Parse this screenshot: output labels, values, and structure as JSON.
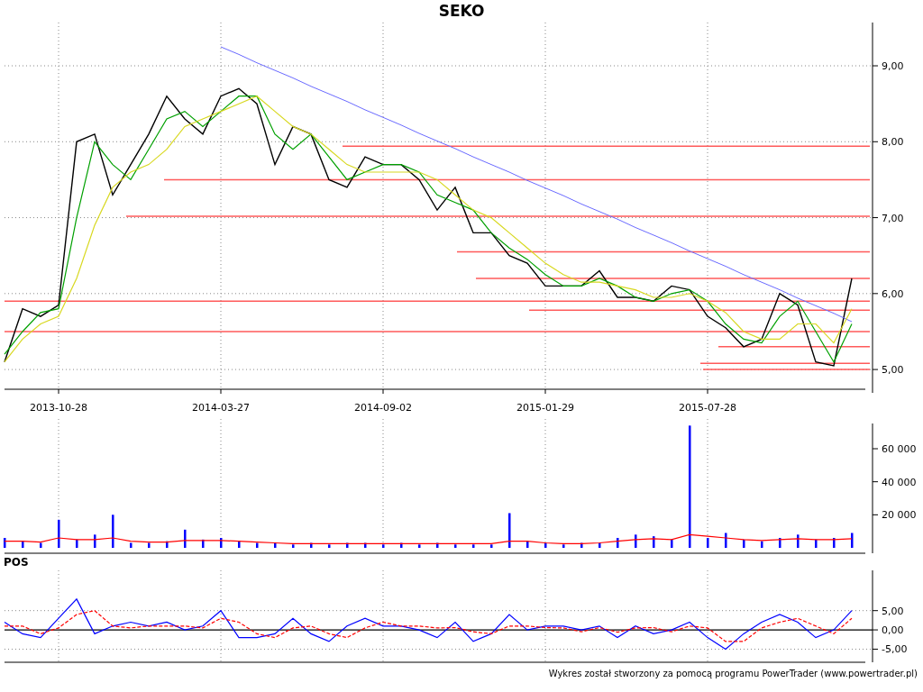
{
  "title": "SEKO",
  "price_panel": {
    "chart_data": {
      "type": "line",
      "grid": true,
      "categories": [
        null,
        null,
        null,
        "2013-10-28",
        null,
        null,
        null,
        null,
        null,
        null,
        null,
        null,
        "2014-03-27",
        null,
        null,
        null,
        null,
        null,
        null,
        null,
        null,
        "2014-09-02",
        null,
        null,
        null,
        null,
        null,
        null,
        null,
        null,
        "2015-01-29",
        null,
        null,
        null,
        null,
        null,
        null,
        null,
        null,
        "2015-07-28",
        null,
        null,
        null,
        null,
        null,
        null,
        null,
        null
      ],
      "ylim": [
        4.74,
        9.57
      ],
      "yticks": [
        {
          "value": 5,
          "label": "5,00"
        },
        {
          "value": 6,
          "label": "6,00"
        },
        {
          "value": 7,
          "label": "7,00"
        },
        {
          "value": 8,
          "label": "8,00"
        },
        {
          "value": 9,
          "label": "9,00"
        }
      ],
      "series": [
        {
          "color": "#000000",
          "values": [
            5.1,
            5.8,
            5.7,
            5.85,
            8.0,
            8.1,
            7.3,
            7.7,
            8.1,
            8.6,
            8.3,
            8.1,
            8.6,
            8.7,
            8.5,
            7.7,
            8.2,
            8.1,
            7.5,
            7.4,
            7.8,
            7.7,
            7.7,
            7.5,
            7.1,
            7.4,
            6.8,
            6.8,
            6.5,
            6.4,
            6.1,
            6.1,
            6.1,
            6.3,
            5.95,
            5.95,
            5.9,
            6.1,
            6.05,
            5.7,
            5.55,
            5.3,
            5.4,
            6.0,
            5.85,
            5.1,
            5.05,
            6.2
          ]
        },
        {
          "color": "#00a000",
          "values": [
            5.2,
            5.5,
            5.75,
            5.8,
            7.0,
            8.0,
            7.7,
            7.5,
            7.9,
            8.3,
            8.4,
            8.2,
            8.4,
            8.6,
            8.6,
            8.1,
            7.9,
            8.1,
            7.8,
            7.5,
            7.6,
            7.7,
            7.7,
            7.6,
            7.3,
            7.2,
            7.1,
            6.8,
            6.6,
            6.45,
            6.25,
            6.1,
            6.1,
            6.2,
            6.1,
            5.95,
            5.9,
            6.0,
            6.05,
            5.9,
            5.6,
            5.4,
            5.35,
            5.7,
            5.9,
            5.5,
            5.1,
            5.6
          ]
        },
        {
          "color": "#d8d820",
          "values": [
            5.1,
            5.4,
            5.6,
            5.7,
            6.2,
            6.9,
            7.4,
            7.6,
            7.7,
            7.9,
            8.2,
            8.3,
            8.4,
            8.5,
            8.6,
            8.4,
            8.2,
            8.1,
            7.9,
            7.7,
            7.6,
            7.6,
            7.6,
            7.6,
            7.5,
            7.3,
            7.1,
            7.0,
            6.8,
            6.6,
            6.4,
            6.25,
            6.15,
            6.15,
            6.1,
            6.05,
            5.95,
            5.95,
            6.0,
            5.9,
            5.75,
            5.5,
            5.4,
            5.4,
            5.6,
            5.6,
            5.35,
            5.8
          ]
        },
        {
          "color": "#6a6aff",
          "values": [
            null,
            null,
            null,
            null,
            null,
            null,
            null,
            null,
            null,
            null,
            null,
            null,
            9.25,
            9.15,
            9.04,
            8.94,
            8.84,
            8.73,
            8.63,
            8.53,
            8.42,
            8.32,
            8.22,
            8.11,
            8.01,
            7.91,
            7.8,
            7.7,
            7.6,
            7.49,
            7.39,
            7.29,
            7.18,
            7.08,
            6.98,
            6.87,
            6.77,
            6.67,
            6.56,
            6.46,
            6.36,
            6.25,
            6.15,
            6.05,
            5.94,
            5.84,
            5.74,
            5.63
          ]
        }
      ],
      "ref_lines": [
        {
          "axis": "y",
          "value": 7.94,
          "color": "#ff5a5a"
        },
        {
          "axis": "y",
          "value": 7.5,
          "color": "#ff5a5a"
        },
        {
          "axis": "y",
          "value": 7.02,
          "color": "#ff5a5a"
        },
        {
          "axis": "y",
          "value": 6.55,
          "color": "#ff5a5a"
        },
        {
          "axis": "y",
          "value": 6.2,
          "color": "#ff5a5a"
        },
        {
          "axis": "y",
          "value": 5.9,
          "color": "#ff5a5a"
        },
        {
          "axis": "y",
          "value": 5.78,
          "color": "#ff5a5a"
        },
        {
          "axis": "y",
          "value": 5.5,
          "color": "#ff5a5a"
        },
        {
          "axis": "y",
          "value": 5.3,
          "color": "#ff5a5a"
        },
        {
          "axis": "y",
          "value": 5.08,
          "color": "#ff5a5a"
        },
        {
          "axis": "y",
          "value": 5.0,
          "color": "#ff5a5a"
        }
      ]
    }
  },
  "volume_panel": {
    "chart_data": {
      "type": "bar",
      "grid": true,
      "categories": [
        null,
        null,
        null,
        null,
        null,
        null,
        null,
        null,
        null,
        null,
        null,
        null,
        null,
        null,
        null,
        null,
        null,
        null,
        null,
        null,
        null,
        null,
        null,
        null,
        null,
        null,
        null,
        null,
        null,
        null,
        null,
        null,
        null,
        null,
        null,
        null,
        null,
        null,
        null,
        null,
        null,
        null,
        null,
        null,
        null,
        null,
        null,
        null
      ],
      "ylim": [
        0,
        78000
      ],
      "yticks": [
        {
          "value": 20000,
          "label": "20 000"
        },
        {
          "value": 40000,
          "label": "40 000"
        },
        {
          "value": 60000,
          "label": "60 000"
        }
      ],
      "series": [
        {
          "color": "#0000ff",
          "values": [
            6000,
            4000,
            3000,
            17000,
            5000,
            8000,
            20000,
            3000,
            3000,
            4000,
            11000,
            5000,
            6000,
            4000,
            3000,
            3000,
            2000,
            3000,
            2000,
            3000,
            3000,
            2000,
            3000,
            2000,
            3000,
            2000,
            2000,
            2000,
            21000,
            4000,
            3000,
            2000,
            3000,
            3000,
            6000,
            8000,
            7000,
            5000,
            74000,
            6000,
            9000,
            5000,
            4000,
            6000,
            8000,
            5000,
            6000,
            9000
          ]
        },
        {
          "type": "line",
          "color": "#ff0000",
          "values": [
            4000,
            4000,
            3500,
            6000,
            5000,
            5000,
            6000,
            4000,
            3500,
            3500,
            4500,
            4500,
            4500,
            4000,
            3500,
            3000,
            2500,
            2500,
            2500,
            2500,
            2500,
            2500,
            2500,
            2500,
            2500,
            2500,
            2500,
            2500,
            4000,
            4000,
            3000,
            2500,
            2500,
            3000,
            4000,
            5000,
            5500,
            5000,
            8000,
            7000,
            6000,
            5000,
            4500,
            5000,
            5500,
            5000,
            5000,
            5500
          ]
        }
      ]
    }
  },
  "pos_panel": {
    "label": "POS",
    "chart_data": {
      "type": "line",
      "grid": true,
      "categories": [
        null,
        null,
        null,
        null,
        null,
        null,
        null,
        null,
        null,
        null,
        null,
        null,
        null,
        null,
        null,
        null,
        null,
        null,
        null,
        null,
        null,
        null,
        null,
        null,
        null,
        null,
        null,
        null,
        null,
        null,
        null,
        null,
        null,
        null,
        null,
        null,
        null,
        null,
        null,
        null,
        null,
        null,
        null,
        null,
        null,
        null,
        null,
        null
      ],
      "ylim": [
        -8.4,
        15.45
      ],
      "yticks": [
        {
          "value": -5,
          "label": "-5,00"
        },
        {
          "value": 0,
          "label": "0,00"
        },
        {
          "value": 5,
          "label": "5,00"
        }
      ],
      "series": [
        {
          "color": "#0000ff",
          "values": [
            2,
            -1,
            -2,
            3,
            8,
            -1,
            1,
            2,
            1,
            2,
            0,
            1,
            5,
            -2,
            -2,
            -1,
            3,
            -1,
            -3,
            1,
            3,
            1,
            1,
            0,
            -2,
            2,
            -3,
            -1,
            4,
            0,
            1,
            1,
            0,
            1,
            -2,
            1,
            -1,
            0,
            2,
            -2,
            -5,
            -1,
            2,
            4,
            2,
            -2,
            0,
            5
          ]
        },
        {
          "color": "#ff0000",
          "line_style": "dashed",
          "values": [
            1,
            1,
            -1,
            0.5,
            4,
            5,
            1,
            0.5,
            1,
            1,
            1,
            0.5,
            3,
            2,
            -1,
            -2,
            0.5,
            1,
            -1,
            -2,
            0.5,
            2,
            1,
            1,
            0.5,
            0.6,
            -0.5,
            -1,
            1,
            1,
            0.6,
            0.5,
            -0.5,
            0.6,
            -0.6,
            0.5,
            0.6,
            -0.5,
            1,
            0.5,
            -3,
            -3,
            0.5,
            2,
            3,
            1,
            -1,
            3
          ]
        }
      ]
    }
  },
  "footer": "Wykres został stworzony za pomocą programu PowerTrader (www.powertrader.pl)"
}
